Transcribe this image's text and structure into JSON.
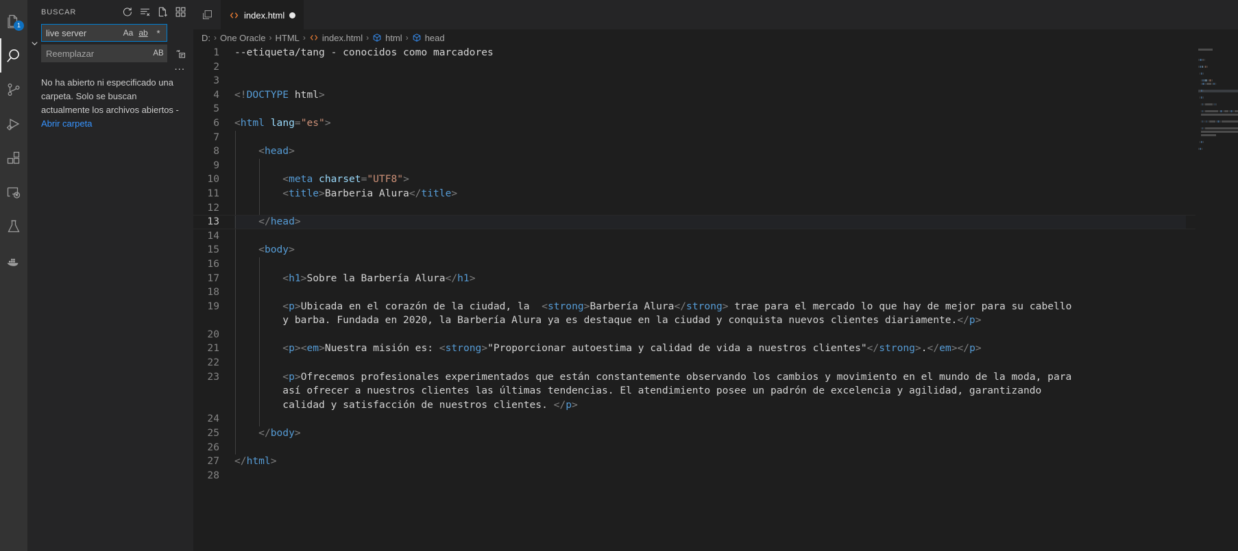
{
  "activitybar": {
    "items": [
      {
        "name": "explorer",
        "icon": "files-icon",
        "badge": "1",
        "active": false
      },
      {
        "name": "search",
        "icon": "search-icon",
        "badge": "",
        "active": true
      },
      {
        "name": "source-control",
        "icon": "source-control-icon",
        "badge": "",
        "active": false
      },
      {
        "name": "run-and-debug",
        "icon": "run-debug-icon",
        "badge": "",
        "active": false
      },
      {
        "name": "extensions",
        "icon": "extensions-icon",
        "badge": "",
        "active": false
      },
      {
        "name": "remote-explorer",
        "icon": "remote-explorer-icon",
        "badge": "",
        "active": false
      },
      {
        "name": "testing",
        "icon": "beaker-icon",
        "badge": "",
        "active": false
      },
      {
        "name": "docker",
        "icon": "docker-whale-icon",
        "badge": "",
        "active": false
      }
    ]
  },
  "sidebar": {
    "title": "BUSCAR",
    "actions": [
      {
        "name": "refresh",
        "icon": "refresh-icon"
      },
      {
        "name": "clear-search-results",
        "icon": "clear-all-icon"
      },
      {
        "name": "open-new-search-editor",
        "icon": "new-file-icon"
      },
      {
        "name": "view-as-tree",
        "icon": "list-tree-icon"
      }
    ],
    "toggle_replace_icon": "chevron-down-icon",
    "search": {
      "value": "live server",
      "placeholder": "Buscar",
      "options": [
        {
          "name": "match-case",
          "label": "Aa"
        },
        {
          "name": "match-whole-word",
          "label": "ab"
        },
        {
          "name": "use-regular-expression",
          "label": "*"
        }
      ]
    },
    "replace": {
      "value": "",
      "placeholder": "Reemplazar",
      "options": [
        {
          "name": "preserve-case",
          "label": "AB"
        }
      ],
      "replace_all_icon": "replace-all-icon"
    },
    "more_actions": "...",
    "message": {
      "text": "No ha abierto ni especificado una carpeta. Solo se buscan actualmente los archivos abiertos -",
      "link": "Abrir carpeta"
    }
  },
  "editor": {
    "split_icon": "split-editor-icon",
    "tabs": [
      {
        "label": "index.html",
        "icon": "html-file-icon",
        "dirty": true,
        "active": true
      }
    ],
    "breadcrumbs": [
      {
        "label": "D:",
        "icon": ""
      },
      {
        "label": "One Oracle",
        "icon": ""
      },
      {
        "label": "HTML",
        "icon": ""
      },
      {
        "label": "index.html",
        "icon": "html-file-icon"
      },
      {
        "label": "html",
        "icon": "symbol-field-icon"
      },
      {
        "label": "head",
        "icon": "symbol-field-icon"
      }
    ],
    "separator": "›",
    "current_line": 13,
    "line_numbers": [
      1,
      2,
      3,
      4,
      5,
      6,
      7,
      8,
      9,
      10,
      11,
      12,
      13,
      14,
      15,
      16,
      17,
      18,
      19,
      20,
      21,
      22,
      23,
      24,
      25,
      26,
      27,
      28
    ],
    "code_lines": [
      {
        "n": 1,
        "rows": 1,
        "indent": 0,
        "tokens": [
          {
            "c": "t-text",
            "t": "--etiqueta/tang - conocidos como marcadores"
          }
        ]
      },
      {
        "n": 2,
        "rows": 1,
        "indent": 0,
        "tokens": []
      },
      {
        "n": 3,
        "rows": 1,
        "indent": 0,
        "tokens": []
      },
      {
        "n": 4,
        "rows": 1,
        "indent": 0,
        "tokens": [
          {
            "c": "t-punct",
            "t": "<!"
          },
          {
            "c": "t-meta",
            "t": "DOCTYPE"
          },
          {
            "c": "t-text",
            "t": " html"
          },
          {
            "c": "t-punct",
            "t": ">"
          }
        ]
      },
      {
        "n": 5,
        "rows": 1,
        "indent": 0,
        "tokens": []
      },
      {
        "n": 6,
        "rows": 1,
        "indent": 0,
        "tokens": [
          {
            "c": "t-punct",
            "t": "<"
          },
          {
            "c": "t-tag",
            "t": "html"
          },
          {
            "c": "t-text",
            "t": " "
          },
          {
            "c": "t-attr",
            "t": "lang"
          },
          {
            "c": "t-punct",
            "t": "="
          },
          {
            "c": "t-str",
            "t": "\"es\""
          },
          {
            "c": "t-punct",
            "t": ">"
          }
        ]
      },
      {
        "n": 7,
        "rows": 1,
        "indent": 1,
        "tokens": []
      },
      {
        "n": 8,
        "rows": 1,
        "indent": 1,
        "tokens": [
          {
            "c": "t-text",
            "t": "    "
          },
          {
            "c": "t-punct",
            "t": "<"
          },
          {
            "c": "t-tag",
            "t": "head"
          },
          {
            "c": "t-punct",
            "t": ">"
          }
        ]
      },
      {
        "n": 9,
        "rows": 1,
        "indent": 2,
        "tokens": []
      },
      {
        "n": 10,
        "rows": 1,
        "indent": 2,
        "tokens": [
          {
            "c": "t-text",
            "t": "        "
          },
          {
            "c": "t-punct",
            "t": "<"
          },
          {
            "c": "t-tag",
            "t": "meta"
          },
          {
            "c": "t-text",
            "t": " "
          },
          {
            "c": "t-attr",
            "t": "charset"
          },
          {
            "c": "t-punct",
            "t": "="
          },
          {
            "c": "t-str",
            "t": "\"UTF8\""
          },
          {
            "c": "t-punct",
            "t": ">"
          }
        ]
      },
      {
        "n": 11,
        "rows": 1,
        "indent": 2,
        "tokens": [
          {
            "c": "t-text",
            "t": "        "
          },
          {
            "c": "t-punct",
            "t": "<"
          },
          {
            "c": "t-tag",
            "t": "title"
          },
          {
            "c": "t-punct",
            "t": ">"
          },
          {
            "c": "t-text",
            "t": "Barberia Alura"
          },
          {
            "c": "t-punct",
            "t": "</"
          },
          {
            "c": "t-tag",
            "t": "title"
          },
          {
            "c": "t-punct",
            "t": ">"
          }
        ]
      },
      {
        "n": 12,
        "rows": 1,
        "indent": 2,
        "tokens": []
      },
      {
        "n": 13,
        "rows": 1,
        "indent": 1,
        "current": true,
        "tokens": [
          {
            "c": "t-text",
            "t": "    "
          },
          {
            "c": "t-punct",
            "t": "</"
          },
          {
            "c": "t-tag",
            "t": "head"
          },
          {
            "c": "t-punct",
            "t": ">"
          }
        ]
      },
      {
        "n": 14,
        "rows": 1,
        "indent": 1,
        "tokens": []
      },
      {
        "n": 15,
        "rows": 1,
        "indent": 1,
        "tokens": [
          {
            "c": "t-text",
            "t": "    "
          },
          {
            "c": "t-punct",
            "t": "<"
          },
          {
            "c": "t-tag",
            "t": "body"
          },
          {
            "c": "t-punct",
            "t": ">"
          }
        ]
      },
      {
        "n": 16,
        "rows": 1,
        "indent": 2,
        "tokens": []
      },
      {
        "n": 17,
        "rows": 1,
        "indent": 2,
        "tokens": [
          {
            "c": "t-text",
            "t": "        "
          },
          {
            "c": "t-punct",
            "t": "<"
          },
          {
            "c": "t-tag",
            "t": "h1"
          },
          {
            "c": "t-punct",
            "t": ">"
          },
          {
            "c": "t-text",
            "t": "Sobre la Barbería Alura"
          },
          {
            "c": "t-punct",
            "t": "</"
          },
          {
            "c": "t-tag",
            "t": "h1"
          },
          {
            "c": "t-punct",
            "t": ">"
          }
        ]
      },
      {
        "n": 18,
        "rows": 1,
        "indent": 2,
        "tokens": []
      },
      {
        "n": 19,
        "rows": 2,
        "indent": 2,
        "tokens": [
          {
            "c": "t-text",
            "t": "        "
          },
          {
            "c": "t-punct",
            "t": "<"
          },
          {
            "c": "t-tag",
            "t": "p"
          },
          {
            "c": "t-punct",
            "t": ">"
          },
          {
            "c": "t-text",
            "t": "Ubicada en el corazón de la ciudad, la  "
          },
          {
            "c": "t-punct",
            "t": "<"
          },
          {
            "c": "t-tag",
            "t": "strong"
          },
          {
            "c": "t-punct",
            "t": ">"
          },
          {
            "c": "t-text",
            "t": "Barbería Alura"
          },
          {
            "c": "t-punct",
            "t": "</"
          },
          {
            "c": "t-tag",
            "t": "strong"
          },
          {
            "c": "t-punct",
            "t": ">"
          },
          {
            "c": "t-text",
            "t": " trae para el mercado lo que hay de mejor para su cabello\n        y barba. Fundada en 2020, la Barbería Alura ya es destaque en la ciudad y conquista nuevos clientes diariamente."
          },
          {
            "c": "t-punct",
            "t": "</"
          },
          {
            "c": "t-tag",
            "t": "p"
          },
          {
            "c": "t-punct",
            "t": ">"
          }
        ]
      },
      {
        "n": 20,
        "rows": 1,
        "indent": 2,
        "tokens": []
      },
      {
        "n": 21,
        "rows": 1,
        "indent": 2,
        "tokens": [
          {
            "c": "t-text",
            "t": "        "
          },
          {
            "c": "t-punct",
            "t": "<"
          },
          {
            "c": "t-tag",
            "t": "p"
          },
          {
            "c": "t-punct",
            "t": ">"
          },
          {
            "c": "t-punct",
            "t": "<"
          },
          {
            "c": "t-tag",
            "t": "em"
          },
          {
            "c": "t-punct",
            "t": ">"
          },
          {
            "c": "t-text",
            "t": "Nuestra misión es: "
          },
          {
            "c": "t-punct",
            "t": "<"
          },
          {
            "c": "t-tag",
            "t": "strong"
          },
          {
            "c": "t-punct",
            "t": ">"
          },
          {
            "c": "t-text",
            "t": "\"Proporcionar autoestima y calidad de vida a nuestros clientes\""
          },
          {
            "c": "t-punct",
            "t": "</"
          },
          {
            "c": "t-tag",
            "t": "strong"
          },
          {
            "c": "t-punct",
            "t": ">"
          },
          {
            "c": "t-text",
            "t": "."
          },
          {
            "c": "t-punct",
            "t": "</"
          },
          {
            "c": "t-tag",
            "t": "em"
          },
          {
            "c": "t-punct",
            "t": ">"
          },
          {
            "c": "t-punct",
            "t": "</"
          },
          {
            "c": "t-tag",
            "t": "p"
          },
          {
            "c": "t-punct",
            "t": ">"
          }
        ]
      },
      {
        "n": 22,
        "rows": 1,
        "indent": 2,
        "tokens": []
      },
      {
        "n": 23,
        "rows": 3,
        "indent": 2,
        "tokens": [
          {
            "c": "t-text",
            "t": "        "
          },
          {
            "c": "t-punct",
            "t": "<"
          },
          {
            "c": "t-tag",
            "t": "p"
          },
          {
            "c": "t-punct",
            "t": ">"
          },
          {
            "c": "t-text",
            "t": "Ofrecemos profesionales experimentados que están constantemente observando los cambios y movimiento en el mundo de la moda, para\n        así ofrecer a nuestros clientes las últimas tendencias. El atendimiento posee un padrón de excelencia y agilidad, garantizando\n        calidad y satisfacción de nuestros clientes. "
          },
          {
            "c": "t-punct",
            "t": "</"
          },
          {
            "c": "t-tag",
            "t": "p"
          },
          {
            "c": "t-punct",
            "t": ">"
          }
        ]
      },
      {
        "n": 24,
        "rows": 1,
        "indent": 2,
        "tokens": []
      },
      {
        "n": 25,
        "rows": 1,
        "indent": 1,
        "tokens": [
          {
            "c": "t-text",
            "t": "    "
          },
          {
            "c": "t-punct",
            "t": "</"
          },
          {
            "c": "t-tag",
            "t": "body"
          },
          {
            "c": "t-punct",
            "t": ">"
          }
        ]
      },
      {
        "n": 26,
        "rows": 1,
        "indent": 1,
        "tokens": []
      },
      {
        "n": 27,
        "rows": 1,
        "indent": 0,
        "tokens": [
          {
            "c": "t-punct",
            "t": "</"
          },
          {
            "c": "t-tag",
            "t": "html"
          },
          {
            "c": "t-punct",
            "t": ">"
          }
        ]
      },
      {
        "n": 28,
        "rows": 1,
        "indent": 0,
        "tokens": []
      }
    ]
  },
  "colors": {
    "background": "#1e1e1e",
    "sidebar_bg": "#252526",
    "activitybar_bg": "#333333",
    "accent": "#007fd4",
    "badge": "#0e70c0",
    "link": "#3794ff",
    "tag": "#569cd6",
    "attr": "#9cdcfe",
    "string": "#ce9178",
    "text": "#d4d4d4",
    "punct": "#808080"
  }
}
